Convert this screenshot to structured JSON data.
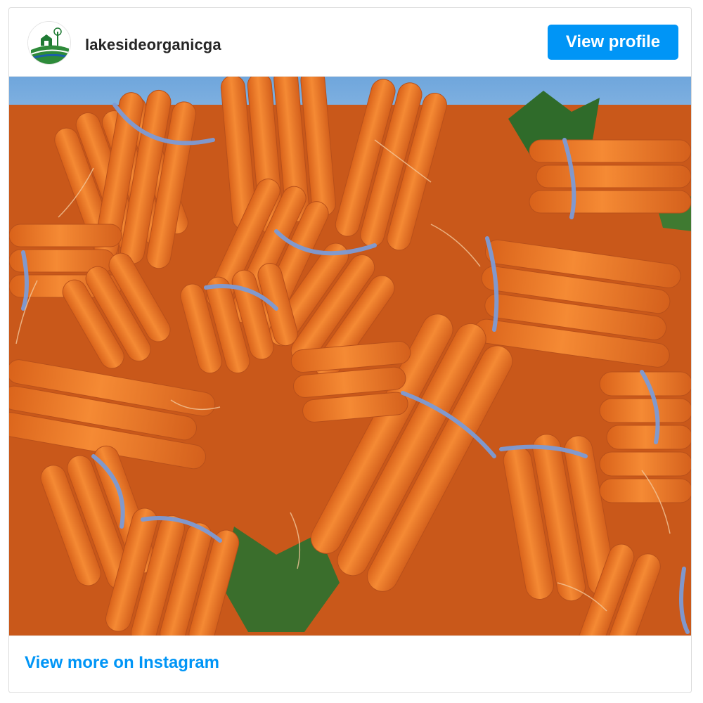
{
  "header": {
    "username": "lakesideorganicga",
    "avatar_icon": "farm-barn-logo-icon",
    "view_profile_label": "View profile"
  },
  "post": {
    "image_subject": "bundles of orange carrots tied with blue bands",
    "image_alt": "Bunches of carrots tied with blue rubber bands under a blue sky"
  },
  "footer": {
    "view_more_label": "View more on Instagram"
  },
  "colors": {
    "accent": "#0095f6",
    "text": "#262626",
    "border": "#dbdbdb",
    "carrot": "#f07f2c",
    "sky": "#7fb3e0",
    "band": "#7c9bd6"
  }
}
